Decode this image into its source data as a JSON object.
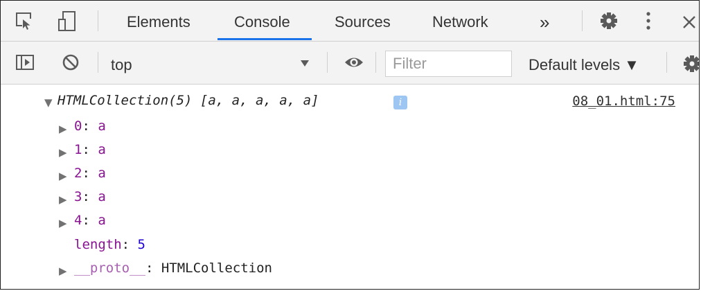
{
  "tabs": [
    {
      "label": "Elements",
      "active": false
    },
    {
      "label": "Console",
      "active": true
    },
    {
      "label": "Sources",
      "active": false
    },
    {
      "label": "Network",
      "active": false
    }
  ],
  "more_tabs_symbol": "»",
  "toolbar": {
    "context": "top",
    "filter_placeholder": "Filter",
    "levels_label": "Default levels ▼"
  },
  "console": {
    "header_text": "HTMLCollection(5) [a, a, a, a, a]",
    "info_badge": "i",
    "source_link": "08_01.html:75",
    "items": [
      {
        "index": "0",
        "sep": ": ",
        "value": "a"
      },
      {
        "index": "1",
        "sep": ": ",
        "value": "a"
      },
      {
        "index": "2",
        "sep": ": ",
        "value": "a"
      },
      {
        "index": "3",
        "sep": ": ",
        "value": "a"
      },
      {
        "index": "4",
        "sep": ": ",
        "value": "a"
      }
    ],
    "length_key": "length",
    "length_sep": ": ",
    "length_value": "5",
    "proto_key": "__proto__",
    "proto_sep": ": ",
    "proto_value": "HTMLCollection"
  },
  "colors": {
    "accent": "#1a73e8",
    "key_purple": "#881391",
    "number_blue": "#1c00cf"
  }
}
